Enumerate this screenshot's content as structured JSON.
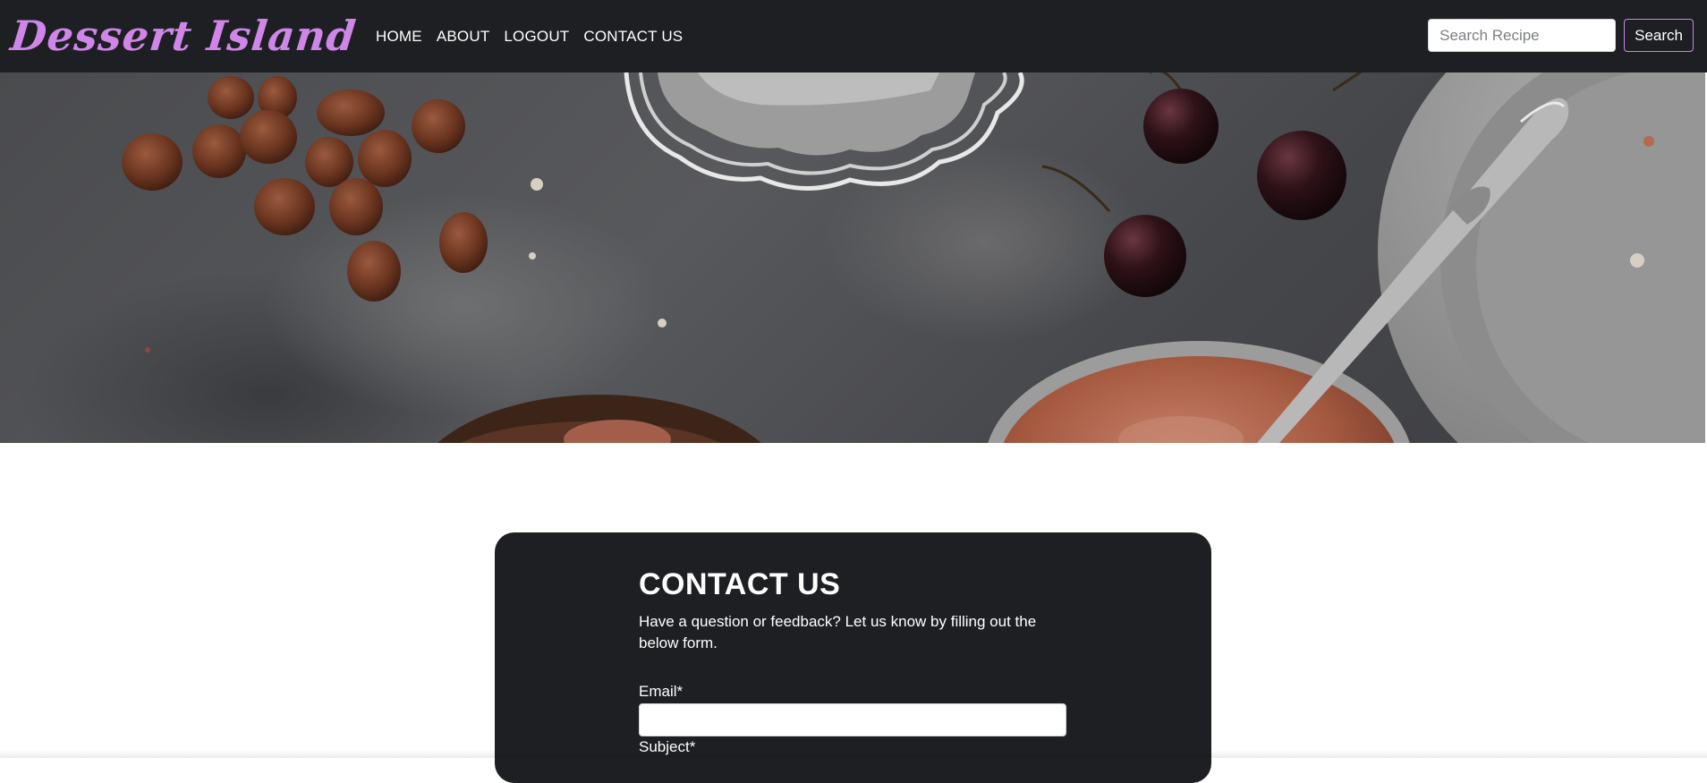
{
  "brand": {
    "name": "Dessert Island",
    "color": "#cf86e8"
  },
  "nav": {
    "links": [
      {
        "label": "HOME"
      },
      {
        "label": "ABOUT"
      },
      {
        "label": "LOGOUT"
      },
      {
        "label": "CONTACT US"
      }
    ]
  },
  "search": {
    "placeholder": "Search Recipe",
    "value": "",
    "button_label": "Search"
  },
  "hero": {
    "icon": "dessert-hero-image"
  },
  "contact": {
    "title": "CONTACT US",
    "description": "Have a question or feedback? Let us know by filling out the below form.",
    "email_label": "Email*",
    "email_value": "",
    "subject_label": "Subject*"
  },
  "colors": {
    "navbar_bg": "#1d1f22",
    "accent": "#cf86e8",
    "card_bg": "#1d1f22"
  }
}
